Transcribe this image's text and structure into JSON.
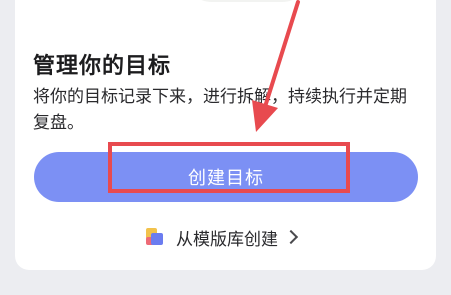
{
  "goal_card": {
    "title": "管理你的目标",
    "description": "将你的目标记录下来，进行拆解，持续执行并定期复盘。",
    "create_button_label": "创建目标",
    "template_link_label": "从模版库创建"
  },
  "annotation": {
    "color": "#e84a4f"
  },
  "colors": {
    "accent": "#7c90f4",
    "background": "#ecedf1"
  }
}
